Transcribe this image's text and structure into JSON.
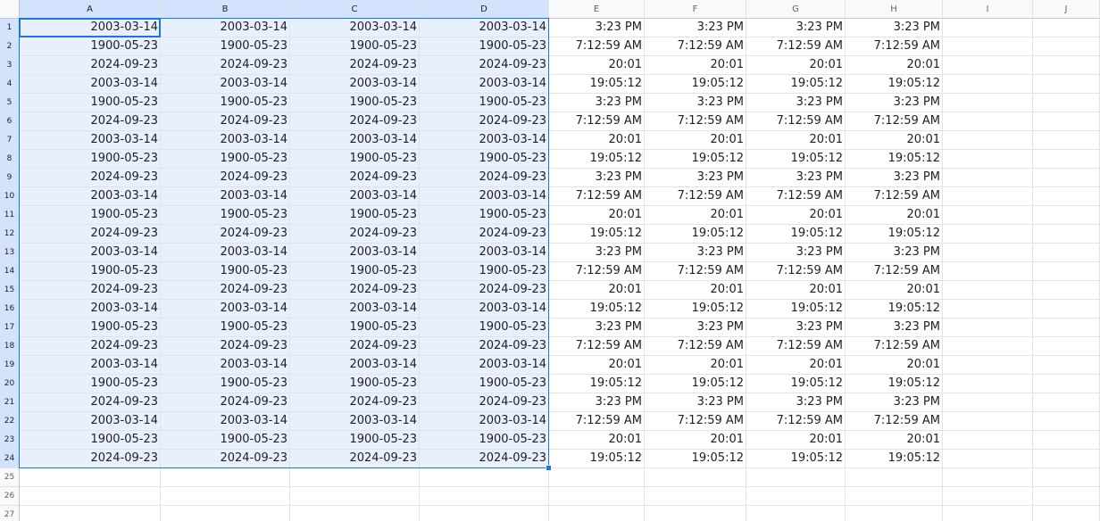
{
  "sheet": {
    "columns": [
      "A",
      "B",
      "C",
      "D",
      "E",
      "F",
      "G",
      "H",
      "I",
      "J"
    ],
    "selected_columns": [
      "A",
      "B",
      "C",
      "D"
    ],
    "row_count": 27,
    "data_rows": 24,
    "selected_rows": 24,
    "selection_range": "A1:D24",
    "active_cell": "A1",
    "accent_color": "#1a73e8",
    "date_pattern": [
      "2003-03-14",
      "1900-05-23",
      "2024-09-23"
    ],
    "time_pattern": [
      "3:23 PM",
      "7:12:59 AM",
      "20:01",
      "19:05:12"
    ]
  }
}
